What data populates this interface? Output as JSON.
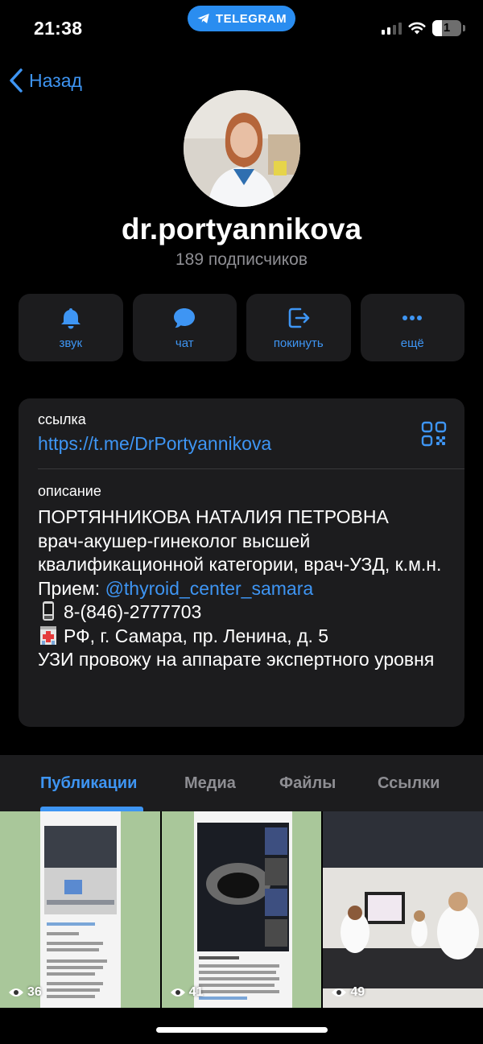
{
  "status_bar": {
    "time": "21:38",
    "pill_label": "TELEGRAM",
    "battery_level": "1",
    "icons": [
      "telegram-icon",
      "signal-icon",
      "wifi-icon",
      "battery-icon"
    ]
  },
  "header": {
    "back_label": "Назад",
    "channel_name": "dr.portyannikova",
    "subscribers": "189 подписчиков"
  },
  "actions": [
    {
      "label": "звук",
      "icon": "bell-icon"
    },
    {
      "label": "чат",
      "icon": "chat-bubble-icon"
    },
    {
      "label": "покинуть",
      "icon": "leave-icon"
    },
    {
      "label": "ещё",
      "icon": "more-dots-icon"
    }
  ],
  "info": {
    "link_label": "ссылка",
    "link_value": "https://t.me/DrPortyannikova",
    "description_label": "описание",
    "description": {
      "name": "ПОРТЯННИКОВА НАТАЛИЯ ПЕТРОВНА",
      "line1": "врач-акушер-гинеколог высшей квалификационной категории, врач-УЗД, к.м.н.",
      "reception_prefix": "Прием: ",
      "reception_mention": "@thyroid_center_samara",
      "phone": "8-(846)-2777703",
      "address": "РФ, г. Самара, пр. Ленина, д. 5",
      "last": "УЗИ провожу на аппарате экспертного уровня"
    }
  },
  "tabs": [
    {
      "label": "Публикации",
      "active": true
    },
    {
      "label": "Медиа",
      "active": false
    },
    {
      "label": "Файлы",
      "active": false
    },
    {
      "label": "Ссылки",
      "active": false
    }
  ],
  "media": [
    {
      "views": "36"
    },
    {
      "views": "41"
    },
    {
      "views": "49"
    }
  ],
  "colors": {
    "accent": "#3e95f3",
    "background": "#000000",
    "card": "#1c1c1e",
    "secondary_text": "#8e8e93"
  }
}
